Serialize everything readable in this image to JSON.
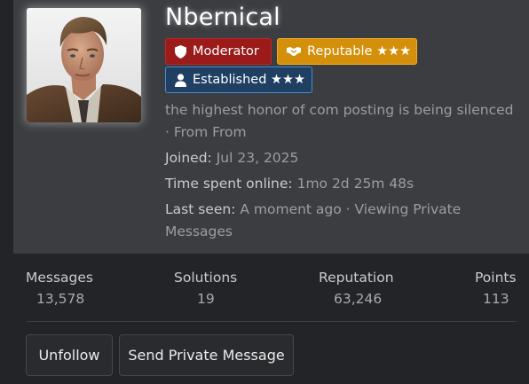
{
  "profile": {
    "username": "Nbernical",
    "badges": {
      "moderator": {
        "label": "Moderator",
        "icon": "shield-icon",
        "color": "#9b1b1b"
      },
      "reputable": {
        "label": "Reputable ★★★",
        "icon": "handshake-icon",
        "color": "#d4900a"
      },
      "established": {
        "label": "Established ★★★",
        "icon": "user-icon",
        "color": "#1f3f63"
      }
    },
    "bio_line1": "the highest honor of com posting is being silenced",
    "bio_line2": "· From From",
    "joined_label": "Joined:",
    "joined_value": "Jul 23, 2025",
    "online_label": "Time spent online:",
    "online_value": "1mo 2d 25m 48s",
    "last_seen_label": "Last seen:",
    "last_seen_value_line1": "A moment ago · Viewing Private",
    "last_seen_value_line2": "Messages"
  },
  "stats": {
    "messages": {
      "label": "Messages",
      "value": "13,578"
    },
    "solutions": {
      "label": "Solutions",
      "value": "19"
    },
    "reputation": {
      "label": "Reputation",
      "value": "63,246"
    },
    "points": {
      "label": "Points",
      "value": "113"
    }
  },
  "actions": {
    "unfollow": "Unfollow",
    "send_pm": "Send Private Message"
  }
}
